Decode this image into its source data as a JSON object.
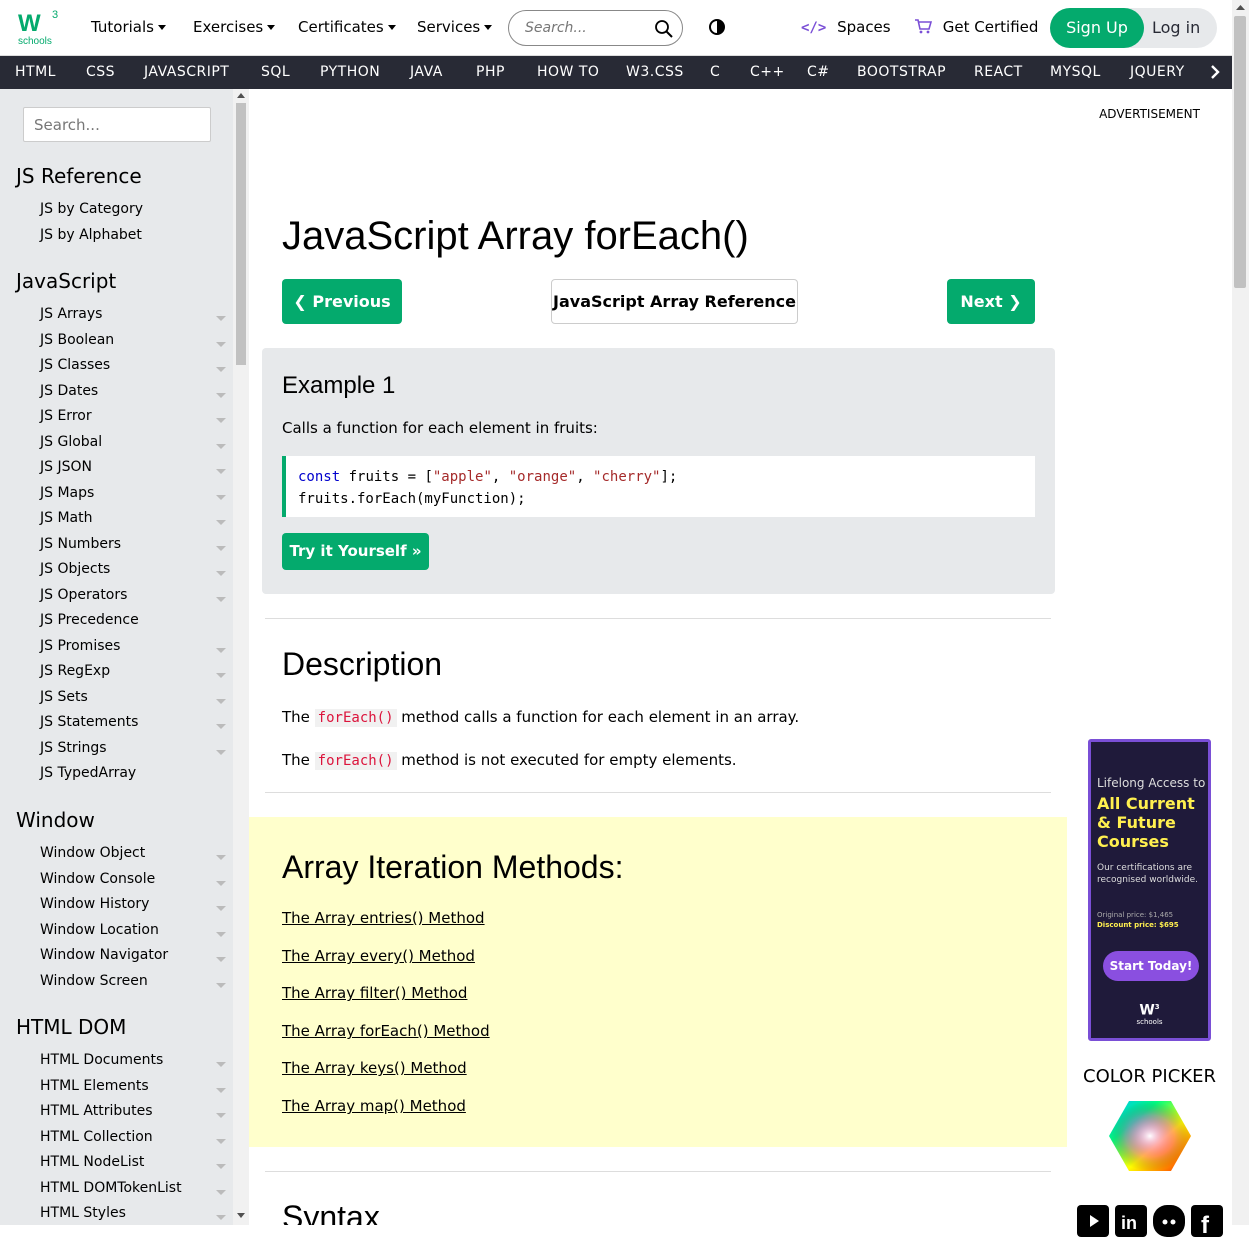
{
  "header": {
    "logo_text": "schools",
    "logo_sup": "3",
    "menu": [
      "Tutorials",
      "Exercises",
      "Certificates",
      "Services"
    ],
    "search_placeholder": "Search...",
    "spaces_label": "Spaces",
    "get_certified_label": "Get Certified",
    "signup_label": "Sign Up",
    "login_label": "Log in"
  },
  "navbar": [
    "HTML",
    "CSS",
    "JAVASCRIPT",
    "SQL",
    "PYTHON",
    "JAVA",
    "PHP",
    "HOW TO",
    "W3.CSS",
    "C",
    "C++",
    "C#",
    "BOOTSTRAP",
    "REACT",
    "MYSQL",
    "JQUERY"
  ],
  "sidebar": {
    "search_placeholder": "Search...",
    "sections": [
      {
        "title": "JS Reference",
        "items": [
          {
            "label": "JS by Category",
            "arrow": false
          },
          {
            "label": "JS by Alphabet",
            "arrow": false
          }
        ]
      },
      {
        "title": "JavaScript",
        "items": [
          {
            "label": "JS Arrays",
            "arrow": true
          },
          {
            "label": "JS Boolean",
            "arrow": true
          },
          {
            "label": "JS Classes",
            "arrow": true
          },
          {
            "label": "JS Dates",
            "arrow": true
          },
          {
            "label": "JS Error",
            "arrow": true
          },
          {
            "label": "JS Global",
            "arrow": true
          },
          {
            "label": "JS JSON",
            "arrow": true
          },
          {
            "label": "JS Maps",
            "arrow": true
          },
          {
            "label": "JS Math",
            "arrow": true
          },
          {
            "label": "JS Numbers",
            "arrow": true
          },
          {
            "label": "JS Objects",
            "arrow": true
          },
          {
            "label": "JS Operators",
            "arrow": true
          },
          {
            "label": "JS Precedence",
            "arrow": false
          },
          {
            "label": "JS Promises",
            "arrow": true
          },
          {
            "label": "JS RegExp",
            "arrow": true
          },
          {
            "label": "JS Sets",
            "arrow": true
          },
          {
            "label": "JS Statements",
            "arrow": true
          },
          {
            "label": "JS Strings",
            "arrow": true
          },
          {
            "label": "JS TypedArray",
            "arrow": false
          }
        ]
      },
      {
        "title": "Window",
        "items": [
          {
            "label": "Window Object",
            "arrow": true
          },
          {
            "label": "Window Console",
            "arrow": true
          },
          {
            "label": "Window History",
            "arrow": true
          },
          {
            "label": "Window Location",
            "arrow": true
          },
          {
            "label": "Window Navigator",
            "arrow": true
          },
          {
            "label": "Window Screen",
            "arrow": true
          }
        ]
      },
      {
        "title": "HTML DOM",
        "items": [
          {
            "label": "HTML Documents",
            "arrow": true
          },
          {
            "label": "HTML Elements",
            "arrow": true
          },
          {
            "label": "HTML Attributes",
            "arrow": true
          },
          {
            "label": "HTML Collection",
            "arrow": true
          },
          {
            "label": "HTML NodeList",
            "arrow": true
          },
          {
            "label": "HTML DOMTokenList",
            "arrow": true
          },
          {
            "label": "HTML Styles",
            "arrow": true
          }
        ]
      }
    ]
  },
  "main": {
    "title": "JavaScript Array forEach()",
    "prev_label": "Previous",
    "ref_label": "JavaScript Array Reference",
    "next_label": "Next",
    "example": {
      "title": "Example 1",
      "text": "Calls a function for each element in fruits:",
      "code_kw": "const",
      "code_line1_a": " fruits = [",
      "code_s1": "\"apple\"",
      "code_s2": "\"orange\"",
      "code_s3": "\"cherry\"",
      "code_line1_end": "];",
      "code_line2": "fruits.forEach(myFunction);",
      "try_label": "Try it Yourself »"
    },
    "description": {
      "title": "Description",
      "p1_a": "The ",
      "p1_code": "forEach()",
      "p1_b": " method calls a function for each element in an array.",
      "p2_a": "The ",
      "p2_code": "forEach()",
      "p2_b": " method is not executed for empty elements."
    },
    "iteration": {
      "title": "Array Iteration Methods:",
      "links": [
        "The Array entries() Method",
        "The Array every() Method",
        "The Array filter() Method",
        "The Array forEach() Method",
        "The Array keys() Method",
        "The Array map() Method"
      ]
    },
    "syntax_title": "Syntax"
  },
  "right": {
    "ad_label": "ADVERTISEMENT",
    "promo": {
      "line1": "Lifelong Access to",
      "line2": "All Current",
      "line3": "& Future",
      "line4": "Courses",
      "sub": "Our certifications are recognised worldwide.",
      "orig": "Original price: $1,465",
      "disc": "Discount price: $695",
      "cta": "Start Today!",
      "logo": "schools"
    },
    "color_picker": "COLOR PICKER"
  },
  "colors": {
    "green": "#04aa6d",
    "dark": "#282a35",
    "yellow": "#ffffcc",
    "gray": "#e7e9eb"
  }
}
